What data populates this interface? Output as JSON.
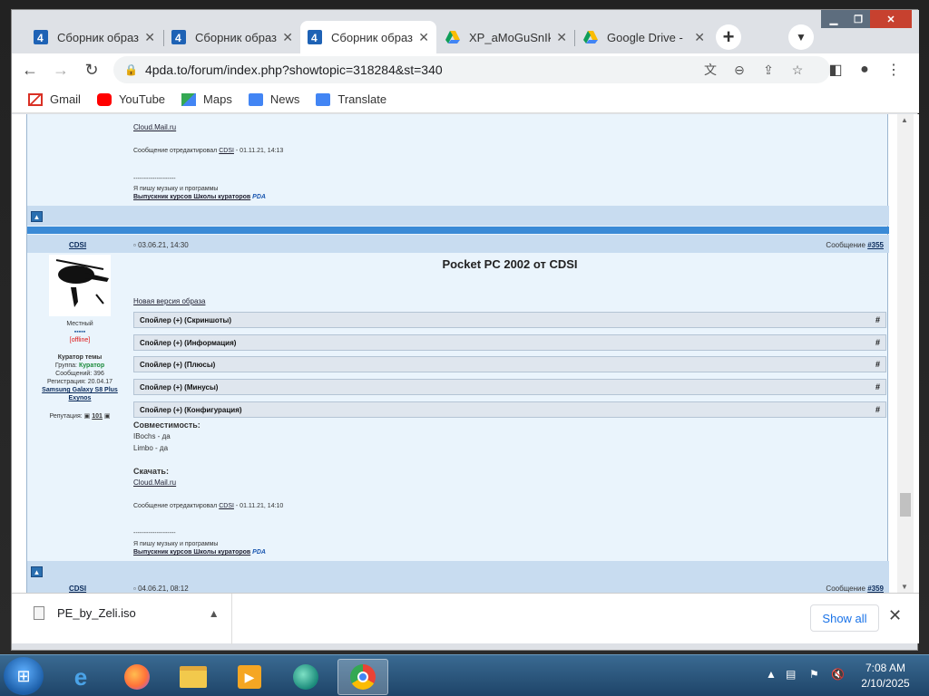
{
  "browser": {
    "tabs": [
      {
        "title": "Сборник образ",
        "icon": "4pda-icon",
        "active": false
      },
      {
        "title": "Сборник образ",
        "icon": "4pda-icon",
        "active": false
      },
      {
        "title": "Сборник образ",
        "icon": "4pda-icon",
        "active": true
      },
      {
        "title": "XP_aMoGuSnIk",
        "icon": "google-drive-icon",
        "active": false
      },
      {
        "title": "Google Drive - ",
        "icon": "google-drive-icon",
        "active": false
      }
    ],
    "url": "4pda.to/forum/index.php?showtopic=318284&st=340",
    "bookmarks": [
      "Gmail",
      "YouTube",
      "Maps",
      "News",
      "Translate"
    ]
  },
  "forum": {
    "top_post": {
      "download_link": "Cloud.Mail.ru",
      "edited_note_prefix": "Сообщение отредактировал",
      "edited_by": "CDSI",
      "edited_date": "- 01.11.21, 14:13",
      "sig_separator": "--------------------",
      "sig_line1": "Я пишу музыку и программы",
      "sig_line2": "Выпускник курсов Школы кураторов",
      "sig_badge": "PDA"
    },
    "post": {
      "author": "CDSI",
      "date": "03.06.21, 14:30",
      "msg_prefix": "Сообщение",
      "msg_no": "#355",
      "title": "Pocket PC 2002 от CDSI",
      "intro_link": "Новая версия образа",
      "spoilers": [
        "Спойлер (+) (Скриншоты)",
        "Спойлер (+) (Информация)",
        "Спойлер (+) (Плюсы)",
        "Спойлер (+) (Минусы)",
        "Спойлер (+) (Конфигурация)"
      ],
      "spoiler_hash": "#",
      "compat_heading": "Совместимость:",
      "compat_1": "IBochs - да",
      "compat_2": "Limbo - да",
      "download_heading": "Скачать:",
      "download_link": "Cloud.Mail.ru",
      "edited_note_prefix": "Сообщение отредактировал",
      "edited_by": "CDSI",
      "edited_date": "- 01.11.21, 14:10",
      "sig_separator": "--------------------",
      "sig_line1": "Я пишу музыку и программы",
      "sig_line2": "Выпускник курсов Школы кураторов",
      "sig_badge": "PDA"
    },
    "profile": {
      "rank": "Местный",
      "status": "[offline]",
      "role": "Куратор темы",
      "group_label": "Группа:",
      "group_value": "Куратор",
      "messages": "Сообщений: 396",
      "registered": "Регистрация: 20.04.17",
      "device": "Samsung Galaxy S8 Plus Exynos",
      "reputation_label": "Репутация:",
      "reputation_value": "101"
    },
    "next_post": {
      "author": "CDSI",
      "date": "04.06.21, 08:12",
      "msg_prefix": "Сообщение",
      "msg_no": "#359"
    }
  },
  "downloads": {
    "file": "PE_by_Zeli.iso",
    "show_all": "Show all"
  },
  "taskbar": {
    "time": "7:08 AM",
    "date": "2/10/2025"
  }
}
